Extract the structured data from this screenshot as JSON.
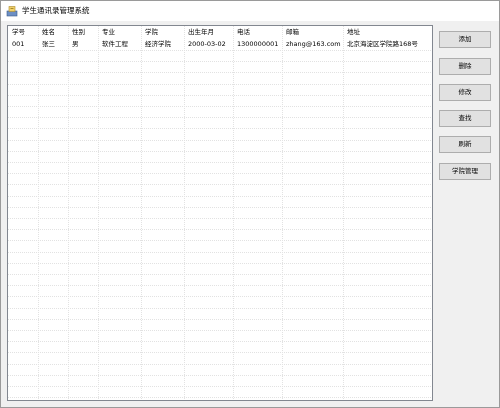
{
  "window": {
    "title": "学生通讯录管理系统",
    "icon": "app-icon"
  },
  "table": {
    "columns": [
      "学号",
      "姓名",
      "性别",
      "专业",
      "学院",
      "出生年月",
      "电话",
      "邮箱",
      "地址"
    ],
    "rows": [
      [
        "001",
        "张三",
        "男",
        "软件工程",
        "经济学院",
        "2000-03-02",
        "1300000001",
        "zhang@163.com",
        "北京海淀区学院路168号"
      ]
    ]
  },
  "buttons": {
    "add": "添加",
    "delete": "删除",
    "edit": "修改",
    "search": "查找",
    "refresh": "刷新",
    "college_manage": "学院管理"
  },
  "colors": {
    "window_bg": "#f0f0f0",
    "grid_line": "#e2e2e2",
    "button_bg": "#e1e1e1",
    "button_border": "#adadad"
  }
}
